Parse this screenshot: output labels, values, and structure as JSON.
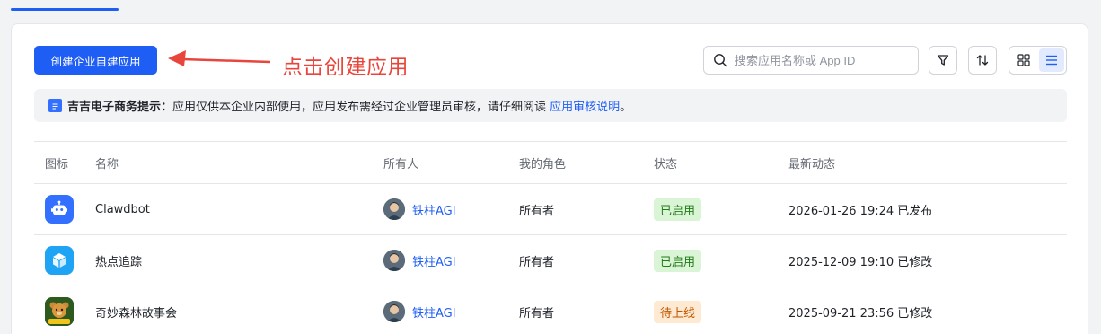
{
  "toolbar": {
    "create_button": "创建企业自建应用",
    "annotation": "点击创建应用",
    "search_placeholder": "搜索应用名称或 App ID"
  },
  "notice": {
    "title": "吉吉电子商务提示：",
    "text": "应用仅供本企业内部使用，应用发布需经过企业管理员审核，请仔细阅读 ",
    "link": "应用审核说明",
    "end": "。"
  },
  "table": {
    "headers": {
      "icon": "图标",
      "name": "名称",
      "owner": "所有人",
      "role": "我的角色",
      "status": "状态",
      "latest": "最新动态"
    },
    "rows": [
      {
        "name": "Clawdbot",
        "owner": "铁柱AGI",
        "role": "所有者",
        "status": "已启用",
        "status_color": "#237b19",
        "latest": "2026-01-26 19:24 已发布",
        "icon": "robot-icon"
      },
      {
        "name": "热点追踪",
        "owner": "铁柱AGI",
        "role": "所有者",
        "status": "已启用",
        "status_color": "#237b19",
        "latest": "2025-12-09 19:10 已修改",
        "icon": "cube-icon"
      },
      {
        "name": "奇妙森林故事会",
        "owner": "铁柱AGI",
        "role": "所有者",
        "status": "待上线",
        "status_color": "#c25700",
        "latest": "2025-09-21 23:56 已修改",
        "icon": "bear-forest-icon"
      }
    ]
  },
  "colors": {
    "primary": "#1f5ef5",
    "annotation": "#e8453c"
  }
}
